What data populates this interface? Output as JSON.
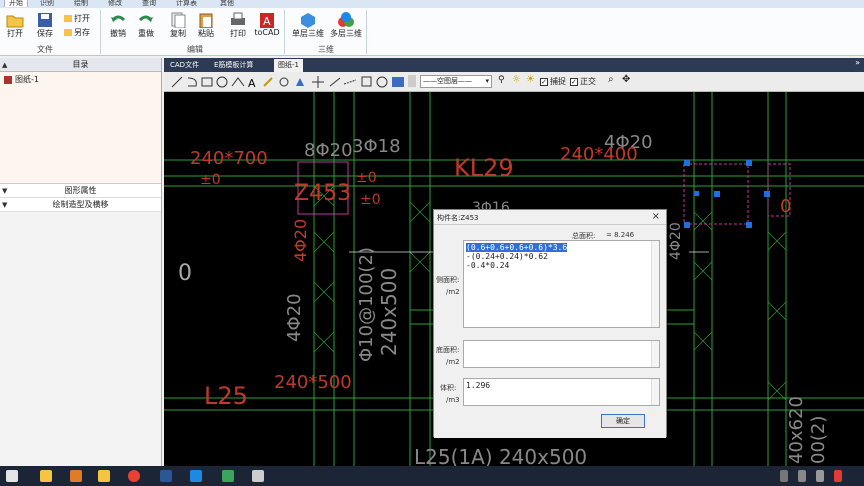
{
  "ribbon": {
    "tabs": [
      "开始",
      "识别",
      "绘制",
      "修改",
      "查询",
      "计算表",
      "其他"
    ],
    "open": "打开",
    "save": "保存",
    "open2": "打开",
    "saveas": "另存",
    "group_file": "文件",
    "undo": "撤销",
    "redo": "重做",
    "copy": "复制",
    "paste": "粘贴",
    "print": "打印",
    "tocad": "toCAD",
    "group_edit": "编辑",
    "single3d": "单层三维",
    "multi3d": "多层三维",
    "group_3d": "三维"
  },
  "left_panel": {
    "header": "目录",
    "tree_item": "图纸-1",
    "section1": "图形属性",
    "section2": "绘制造型及横移"
  },
  "doc_tabs": [
    "CAD文件",
    "E筋模板计算",
    "图纸-1"
  ],
  "toolbar": {
    "layer_select": "——空图层——",
    "snap": "捕捉",
    "ortho": "正交"
  },
  "cad": {
    "t1": "240*700",
    "t2": "8Φ20",
    "t3": "3Φ18",
    "t4": "4Φ20",
    "t5": "240*400",
    "t6": "Z453",
    "t7": "3Φ16",
    "t8": "4Φ20",
    "t9": "Φ10@100(2)",
    "t10": "240x500",
    "t11": "4Φ20",
    "t12": "L25",
    "t13": "240*500",
    "t14": "L25(1A) 240x500",
    "t15": "40x620",
    "t16": "00(2)",
    "t17": "±0",
    "t18": "±0",
    "t19": "±0",
    "t20": "KL29",
    "t21": "4Φ20",
    "t22": "0",
    "t23": "0"
  },
  "dialog": {
    "title": "构件名:Z453",
    "total_label": "总面积:",
    "total_value": "= 8.246",
    "side_label": "侧面积:",
    "side_unit": "/m2",
    "side_line1": "(0.6+0.6+0.6+0.6)*3.6",
    "side_line2": "-(0.24+0.24)*0.62",
    "side_line3": "-0.4*0.24",
    "bottom_label": "底面积:",
    "bottom_unit": "/m2",
    "volume_label": "体积:",
    "volume_unit": "/m3",
    "volume_value": "1.296",
    "ok": "确定"
  }
}
